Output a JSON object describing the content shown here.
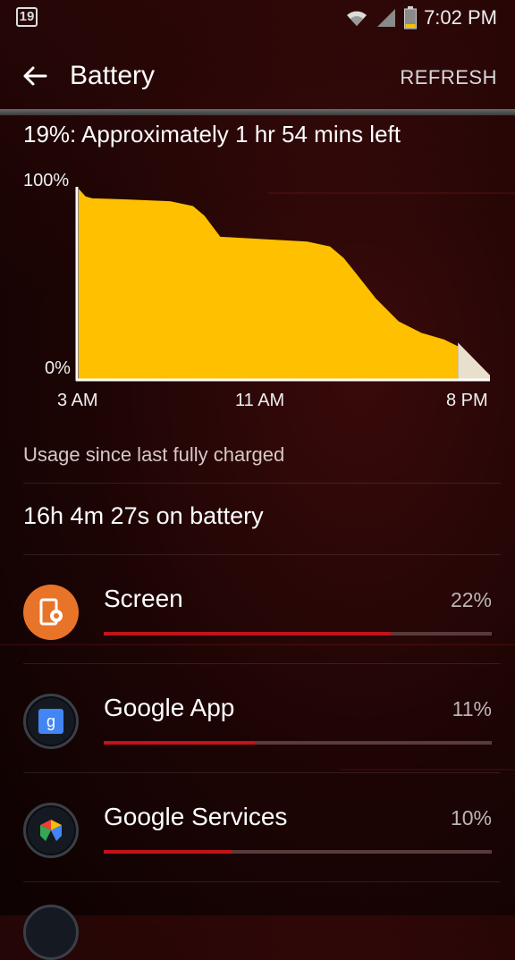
{
  "status_bar": {
    "notification_count": "19",
    "time": "7:02 PM",
    "icons": [
      "wifi-icon",
      "signal-icon",
      "battery-icon"
    ]
  },
  "app_bar": {
    "title": "Battery",
    "back_icon": "arrow-left-icon",
    "refresh_label": "REFRESH"
  },
  "estimate_text": "19%: Approximately 1 hr 54 mins left",
  "chart_data": {
    "type": "area",
    "y_ticks": [
      "100%",
      "0%"
    ],
    "x_ticks": [
      "3 AM",
      "11 AM",
      "8 PM"
    ],
    "ylim": [
      0,
      100
    ],
    "xlim_hours_of_day": [
      3,
      21
    ],
    "series": [
      {
        "kind": "history",
        "color": "#ffc000",
        "points": [
          [
            3.0,
            99
          ],
          [
            3.3,
            95
          ],
          [
            3.6,
            94
          ],
          [
            5.0,
            93.5
          ],
          [
            7.0,
            92.5
          ],
          [
            8.0,
            90
          ],
          [
            8.5,
            85
          ],
          [
            9.2,
            74
          ],
          [
            10.0,
            73.5
          ],
          [
            11.5,
            72.5
          ],
          [
            13.0,
            71.5
          ],
          [
            14.0,
            69
          ],
          [
            14.6,
            63
          ],
          [
            15.2,
            54
          ],
          [
            16.0,
            42
          ],
          [
            17.0,
            30
          ],
          [
            18.0,
            24
          ],
          [
            19.0,
            20.5
          ],
          [
            19.6,
            17
          ]
        ]
      },
      {
        "kind": "projection",
        "color": "#e8e0cc",
        "points": [
          [
            19.6,
            19
          ],
          [
            21.0,
            2
          ]
        ]
      }
    ]
  },
  "usage_header": "Usage since last fully charged",
  "on_battery": "16h 4m 27s on battery",
  "accent_color": "#c4121a",
  "apps": [
    {
      "name": "Screen",
      "percent_label": "22%",
      "bar_fraction": 0.74,
      "icon": "screen-settings-icon",
      "icon_color": "#e8742a"
    },
    {
      "name": "Google App",
      "percent_label": "11%",
      "bar_fraction": 0.39,
      "icon": "google-app-icon",
      "icon_color": "#4285f4"
    },
    {
      "name": "Google Services",
      "percent_label": "10%",
      "bar_fraction": 0.33,
      "icon": "google-services-icon",
      "icon_color": "#34a853"
    }
  ]
}
